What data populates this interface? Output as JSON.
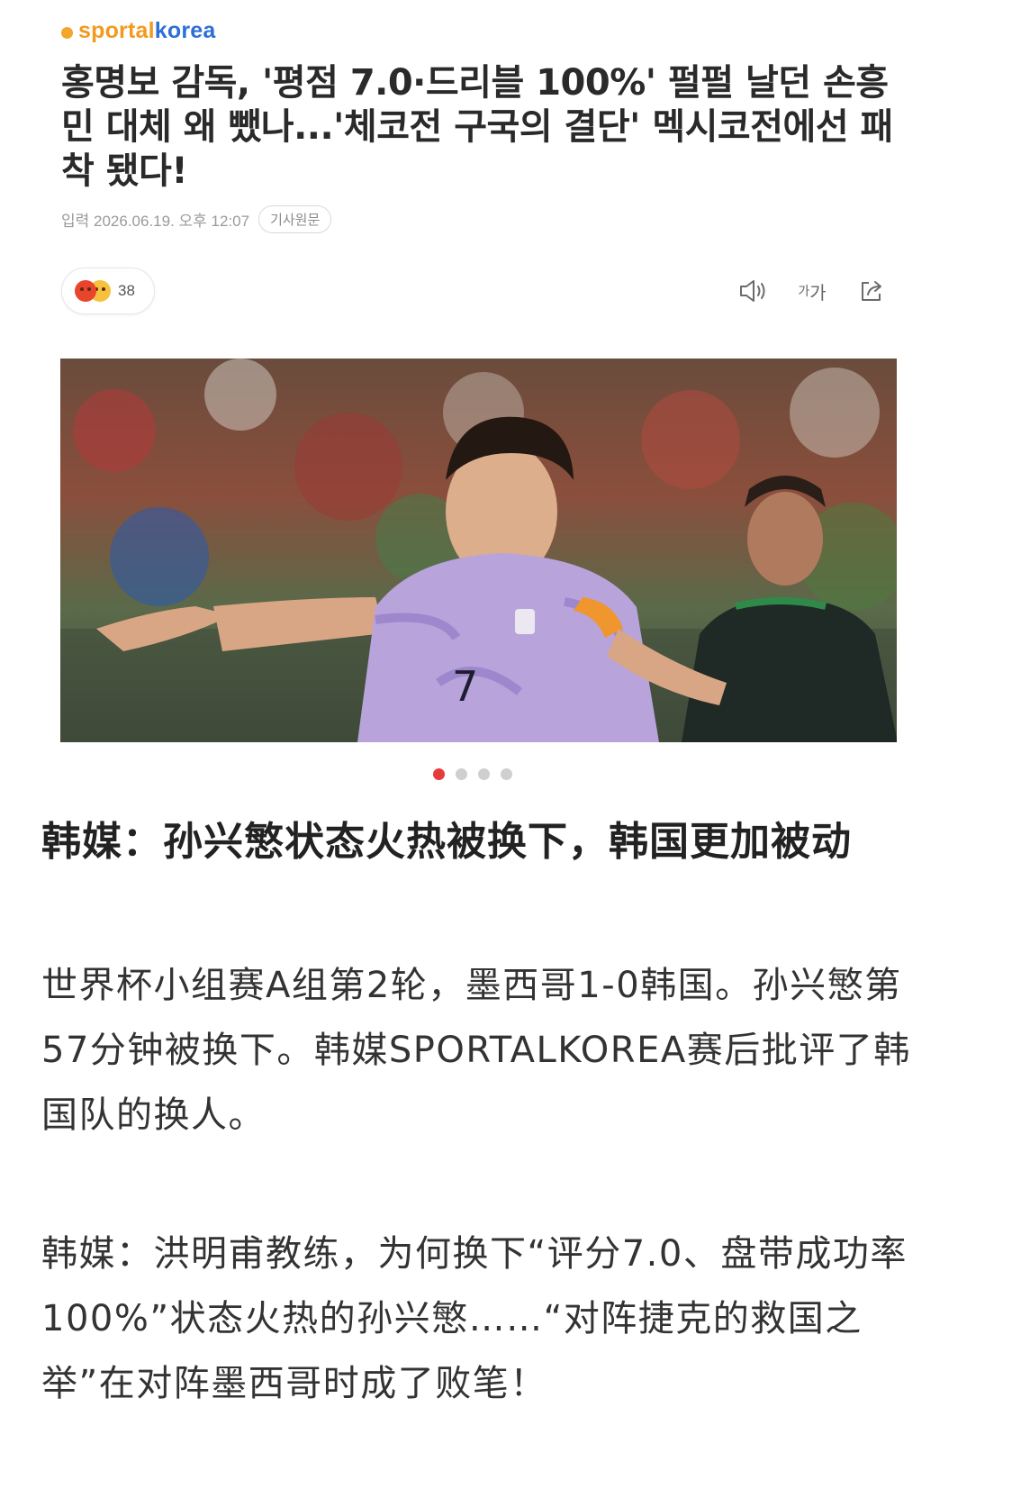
{
  "source": {
    "logo_part1": "sportal",
    "logo_part2": "korea"
  },
  "article": {
    "headline": "홍명보 감독, '평점 7.0·드리블 100%' 펄펄 날던 손흥민 대체 왜 뺐나...'체코전 구국의 결단' 멕시코전에선 패착 됐다!",
    "meta_date": "입력 2026.06.19. 오후 12:07",
    "original_link": "기사원문"
  },
  "reactions": {
    "count": "38"
  },
  "toolbar": {
    "font_size_label_small": "가",
    "font_size_label_large": "가"
  },
  "carousel": {
    "total": 4,
    "active_index": 0
  },
  "zh_title": "韩媒：孙兴慜状态火热被换下，韩国更加被动",
  "paragraphs": [
    "世界杯小组赛A组第2轮，墨西哥1-0韩国。孙兴慜第57分钟被换下。韩媒SPORTALKOREA赛后批评了韩国队的换人。",
    "韩媒：洪明甫教练，为何换下“评分7.0、盘带成功率100%”状态火热的孙兴慜……“对阵捷克的救国之举”在对阵墨西哥时成了败笔！"
  ],
  "colors": {
    "accent_red": "#e63b3b",
    "logo_orange": "#f29a1e",
    "logo_blue": "#2d6fd6"
  }
}
